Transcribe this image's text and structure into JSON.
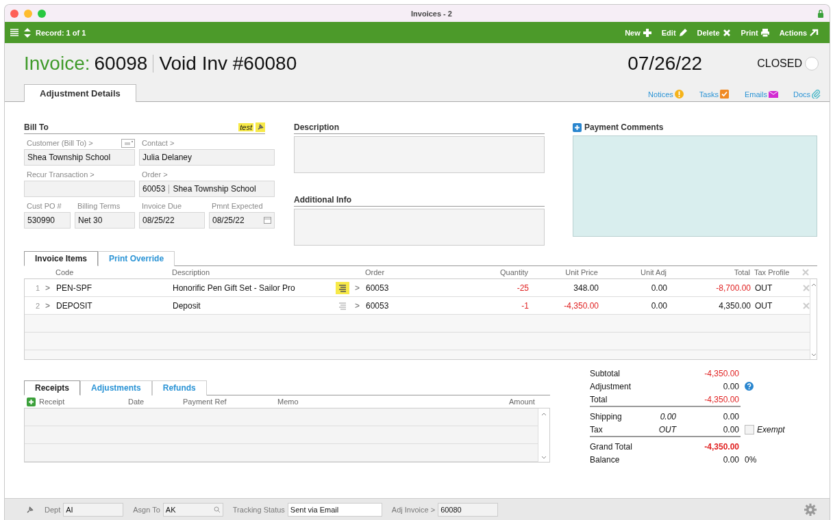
{
  "window": {
    "title": "Invoices - 2"
  },
  "toolbar": {
    "record": "Record: 1 of 1",
    "actions": [
      {
        "label": "New",
        "kind": "plus"
      },
      {
        "label": "Edit",
        "kind": "pencil"
      },
      {
        "label": "Delete",
        "kind": "cross"
      },
      {
        "label": "Print",
        "kind": "printer"
      },
      {
        "label": "Actions",
        "kind": "arrow"
      }
    ]
  },
  "header": {
    "label": "Invoice:",
    "number": "60098",
    "void_ref": "Void Inv #60080",
    "date": "07/26/22",
    "status": "CLOSED",
    "closed": false,
    "links": [
      {
        "label": "Notices",
        "kind": "notice"
      },
      {
        "label": "Tasks",
        "kind": "task"
      },
      {
        "label": "Emails",
        "kind": "email"
      },
      {
        "label": "Docs",
        "kind": "clip"
      }
    ]
  },
  "tabs": [
    {
      "label": "Adjustment Details",
      "selected": true
    }
  ],
  "bill_to": {
    "title": "Bill To",
    "tag": "test",
    "rows": [
      [
        {
          "label": "Customer (Bill To) >",
          "value": "Shea Township School",
          "card": true
        },
        {
          "label": "Contact >",
          "value": "Julia Delaney"
        }
      ],
      [
        {
          "label": "Recur Transaction >"
        },
        {
          "label": "Order >",
          "value": "60053",
          "value_2": "Shea Township School"
        }
      ],
      [
        {
          "label": "Cust PO #",
          "value": "530990"
        },
        {
          "label": "Billing Terms",
          "value": "Net 30"
        },
        {
          "label": "Invoice Due",
          "value": "08/25/22"
        },
        {
          "label": "Pmnt Expected",
          "value": "08/25/22",
          "calendar": true
        }
      ]
    ]
  },
  "description": {
    "title": "Description"
  },
  "additional_info": {
    "title": "Additional Info"
  },
  "payment_comments": {
    "title": "Payment Comments"
  },
  "item_tabs": [
    {
      "label": "Invoice Items",
      "selected": true
    },
    {
      "label": "Print Override",
      "selected": false
    }
  ],
  "items": {
    "columns": [
      "Code",
      "Description",
      "Order",
      "Quantity",
      "Unit Price",
      "Unit Adj",
      "Total",
      "Tax Profile"
    ],
    "rows": [
      {
        "line": "1",
        "toggle": ">",
        "code": "PEN-SPF",
        "description": "Honorific Pen Gift Set - Sailor Pro",
        "has_note": true,
        "order_toggle": ">",
        "order": "60053",
        "quantity": {
          "text": "-25",
          "negative": true
        },
        "unit_price": {
          "text": "348.00",
          "negative": false
        },
        "unit_adj": {
          "text": "0.00",
          "negative": false
        },
        "total": {
          "text": "-8,700.00",
          "negative": true
        },
        "tax_profile": {
          "text": "OUT",
          "negative": false
        }
      },
      {
        "line": "2",
        "toggle": ">",
        "code": "DEPOSIT",
        "description": "Deposit",
        "has_note": false,
        "order_toggle": ">",
        "order": "60053",
        "quantity": {
          "text": "-1",
          "negative": true
        },
        "unit_price": {
          "text": "-4,350.00",
          "negative": true
        },
        "unit_adj": {
          "text": "0.00",
          "negative": false
        },
        "total": {
          "text": "4,350.00",
          "negative": false
        },
        "tax_profile": {
          "text": "OUT",
          "negative": false
        }
      }
    ]
  },
  "payment_tabs": [
    {
      "label": "Receipts",
      "selected": true
    },
    {
      "label": "Adjustments",
      "selected": false
    },
    {
      "label": "Refunds",
      "selected": false
    }
  ],
  "receipts": {
    "columns": [
      "Receipt",
      "Date",
      "Payment Ref",
      "Memo",
      "Amount"
    ]
  },
  "totals": [
    {
      "label": "Subtotal",
      "value": "-4,350.00",
      "red": true
    },
    {
      "label": "Adjustment",
      "value": "0.00",
      "help": true
    },
    {
      "label": "Total",
      "value": "-4,350.00",
      "red": true,
      "rule": true
    },
    {
      "label": "Shipping",
      "middle": "0.00",
      "value": "0.00"
    },
    {
      "label": "Tax",
      "middle": "OUT",
      "value": "0.00",
      "exempt": {
        "label": "Exempt",
        "checked": false
      },
      "rule": true
    },
    {
      "label": "Grand Total",
      "value": "-4,350.00",
      "red": true,
      "bold": true
    },
    {
      "label": "Balance",
      "value": "0.00",
      "extra": "0%"
    }
  ],
  "footer": {
    "fields": [
      {
        "label": "Dept",
        "value": "AI"
      },
      {
        "label": "Asgn To",
        "value": "AK",
        "search": true
      },
      {
        "label": "Tracking Status",
        "value": "Sent via Email",
        "wide": true
      },
      {
        "label": "Adj Invoice >",
        "value": "60080"
      }
    ]
  }
}
